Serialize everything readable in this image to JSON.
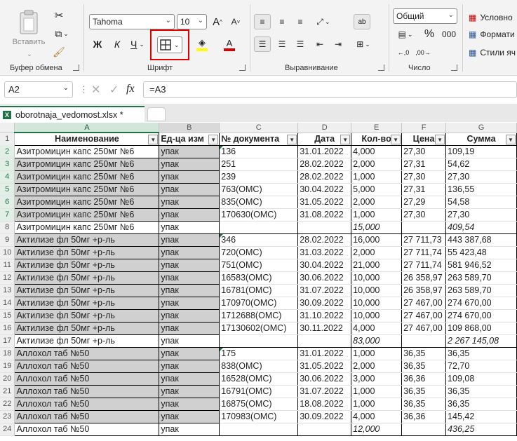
{
  "ribbon": {
    "clipboard": {
      "paste_label": "Вставить",
      "group_label": "Буфер обмена"
    },
    "font": {
      "name": "Tahoma",
      "size": "10",
      "group_label": "Шрифт",
      "bold": "Ж",
      "italic": "К",
      "underline": "Ч"
    },
    "alignment": {
      "group_label": "Выравнивание"
    },
    "number": {
      "format": "Общий",
      "group_label": "Число",
      "percent": "%"
    },
    "styles": {
      "conditional": "Условно",
      "format_table": "Формати",
      "cell_styles": "Стили яч"
    },
    "colors": {
      "highlight": "#ffff00",
      "font_color": "#d00000",
      "callout": "#e00000"
    }
  },
  "formula_bar": {
    "name_box": "A2",
    "fx": "fx",
    "formula": "=A3"
  },
  "tabs": [
    {
      "label": "oborotnaja_vedomost.xlsx *"
    }
  ],
  "columns": [
    "A",
    "B",
    "C",
    "D",
    "E",
    "F",
    "G"
  ],
  "headers": [
    "Наименование",
    "Ед-ца изм",
    "№ документа",
    "Дата",
    "Кол-во",
    "Цена",
    "Сумма"
  ],
  "rows": [
    {
      "n": "2",
      "a": "Азитромицин капс 250мг №6",
      "b": "упак",
      "c": "136",
      "d": "31.01.2022",
      "e": "4,000",
      "f": "27,30",
      "g": "109,19"
    },
    {
      "n": "3",
      "a": "Азитромицин капс 250мг №6",
      "b": "упак",
      "c": "251",
      "d": "28.02.2022",
      "e": "2,000",
      "f": "27,31",
      "g": "54,62"
    },
    {
      "n": "4",
      "a": "Азитромицин капс 250мг №6",
      "b": "упак",
      "c": "239",
      "d": "28.02.2022",
      "e": "1,000",
      "f": "27,30",
      "g": "27,30"
    },
    {
      "n": "5",
      "a": "Азитромицин капс 250мг №6",
      "b": "упак",
      "c": "763(ОМС)",
      "d": "30.04.2022",
      "e": "5,000",
      "f": "27,31",
      "g": "136,55"
    },
    {
      "n": "6",
      "a": "Азитромицин капс 250мг №6",
      "b": "упак",
      "c": "835(ОМС)",
      "d": "31.05.2022",
      "e": "2,000",
      "f": "27,29",
      "g": "54,58"
    },
    {
      "n": "7",
      "a": "Азитромицин капс 250мг №6",
      "b": "упак",
      "c": "170630(ОМС)",
      "d": "31.08.2022",
      "e": "1,000",
      "f": "27,30",
      "g": "27,30"
    },
    {
      "n": "8",
      "a": "Азитромицин капс 250мг №6",
      "b": "упак",
      "c": "",
      "d": "",
      "e": "15,000",
      "f": "",
      "g": "409,54",
      "total": true
    },
    {
      "n": "9",
      "a": "Актилизе фл 50мг +р-ль",
      "b": "упак",
      "c": "346",
      "d": "28.02.2022",
      "e": "16,000",
      "f": "27 711,73",
      "g": "443 387,68"
    },
    {
      "n": "10",
      "a": "Актилизе фл 50мг +р-ль",
      "b": "упак",
      "c": "720(ОМС)",
      "d": "31.03.2022",
      "e": "2,000",
      "f": "27 711,74",
      "g": "55 423,48"
    },
    {
      "n": "11",
      "a": "Актилизе фл 50мг +р-ль",
      "b": "упак",
      "c": "751(ОМС)",
      "d": "30.04.2022",
      "e": "21,000",
      "f": "27 711,74",
      "g": "581 946,52"
    },
    {
      "n": "12",
      "a": "Актилизе фл 50мг +р-ль",
      "b": "упак",
      "c": "16583(ОМС)",
      "d": "30.06.2022",
      "e": "10,000",
      "f": "26 358,97",
      "g": "263 589,70"
    },
    {
      "n": "13",
      "a": "Актилизе фл 50мг +р-ль",
      "b": "упак",
      "c": "16781(ОМС)",
      "d": "31.07.2022",
      "e": "10,000",
      "f": "26 358,97",
      "g": "263 589,70"
    },
    {
      "n": "14",
      "a": "Актилизе фл 50мг +р-ль",
      "b": "упак",
      "c": "170970(ОМС)",
      "d": "30.09.2022",
      "e": "10,000",
      "f": "27 467,00",
      "g": "274 670,00"
    },
    {
      "n": "15",
      "a": "Актилизе фл 50мг +р-ль",
      "b": "упак",
      "c": "1712688(ОМС)",
      "d": "31.10.2022",
      "e": "10,000",
      "f": "27 467,00",
      "g": "274 670,00"
    },
    {
      "n": "16",
      "a": "Актилизе фл 50мг +р-ль",
      "b": "упак",
      "c": "17130602(ОМС)",
      "d": "30.11.2022",
      "e": "4,000",
      "f": "27 467,00",
      "g": "109 868,00"
    },
    {
      "n": "17",
      "a": "Актилизе фл 50мг +р-ль",
      "b": "упак",
      "c": "",
      "d": "",
      "e": "83,000",
      "f": "",
      "g": "2 267 145,08",
      "total": true
    },
    {
      "n": "18",
      "a": "Аллохол таб №50",
      "b": "упак",
      "c": "175",
      "d": "31.01.2022",
      "e": "1,000",
      "f": "36,35",
      "g": "36,35"
    },
    {
      "n": "19",
      "a": "Аллохол таб №50",
      "b": "упак",
      "c": "838(ОМС)",
      "d": "31.05.2022",
      "e": "2,000",
      "f": "36,35",
      "g": "72,70"
    },
    {
      "n": "20",
      "a": "Аллохол таб №50",
      "b": "упак",
      "c": "16528(ОМС)",
      "d": "30.06.2022",
      "e": "3,000",
      "f": "36,36",
      "g": "109,08"
    },
    {
      "n": "21",
      "a": "Аллохол таб №50",
      "b": "упак",
      "c": "16791(ОМС)",
      "d": "31.07.2022",
      "e": "1,000",
      "f": "36,35",
      "g": "36,35"
    },
    {
      "n": "22",
      "a": "Аллохол таб №50",
      "b": "упак",
      "c": "16875(ОМС)",
      "d": "18.08.2022",
      "e": "1,000",
      "f": "36,35",
      "g": "36,35"
    },
    {
      "n": "23",
      "a": "Аллохол таб №50",
      "b": "упак",
      "c": "170983(ОМС)",
      "d": "30.09.2022",
      "e": "4,000",
      "f": "36,36",
      "g": "145,42"
    },
    {
      "n": "24",
      "a": "Аллохол таб №50",
      "b": "упак",
      "c": "",
      "d": "",
      "e": "12,000",
      "f": "",
      "g": "436,25",
      "total": true
    }
  ]
}
